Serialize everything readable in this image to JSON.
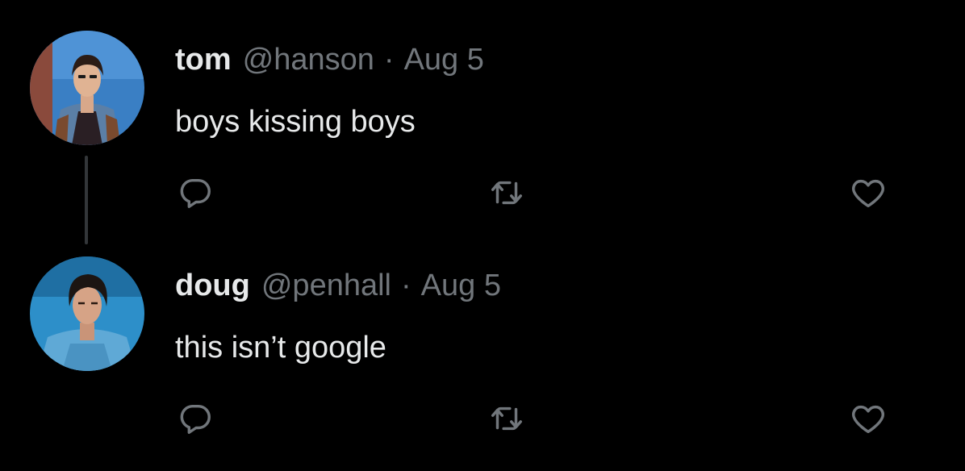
{
  "colors": {
    "background": "#000000",
    "primary_text": "#e7e9ea",
    "secondary_text": "#71767b",
    "thread_line": "#333639"
  },
  "tweets": [
    {
      "display_name": "tom",
      "handle": "@hanson",
      "separator": "·",
      "date": "Aug 5",
      "text": "boys kissing boys",
      "avatar_alt": "tom profile photo",
      "icons": [
        "reply-icon",
        "retweet-icon",
        "like-icon"
      ]
    },
    {
      "display_name": "doug",
      "handle": "@penhall",
      "separator": "·",
      "date": "Aug 5",
      "text": "this isn’t google",
      "avatar_alt": "doug profile photo",
      "icons": [
        "reply-icon",
        "retweet-icon",
        "like-icon"
      ]
    }
  ]
}
